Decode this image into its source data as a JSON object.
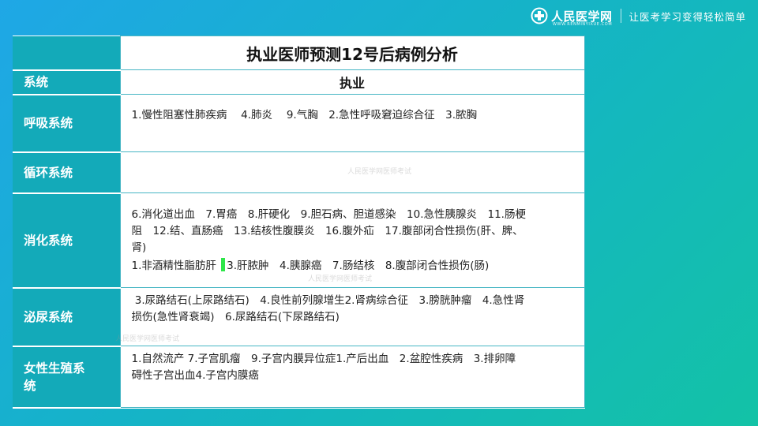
{
  "brand": {
    "name": "人民医学网",
    "site": "WWW.RENMINYIXUE.COM",
    "slogan": "让医考学习变得轻松简单"
  },
  "table": {
    "title": "执业医师预测12号后病例分析",
    "header_label": "系统",
    "header_value": "执业",
    "rows": [
      {
        "label": "呼吸系统",
        "lines": [
          "1.慢性阻塞性肺疾病　 4.肺炎　 9.气胸　2.急性呼吸窘迫综合征　3.脓胸"
        ]
      },
      {
        "label": "循环系统",
        "lines": []
      },
      {
        "label": "消化系统",
        "lines": [
          "6.消化道出血　7.胃癌　8.肝硬化　9.胆石病、胆道感染　10.急性胰腺炎　11.肠梗",
          "阻　12.结、直肠癌　13.结核性腹膜炎　16.腹外疝　17.腹部闭合性损伤(肝、脾、",
          "肾)"
        ],
        "line4_a": "1.非酒精性脂肪肝 ",
        "line4_b": "3.肝脓肿　4.胰腺癌　7.肠结核　8.腹部闭合性损伤(肠)"
      },
      {
        "label": "泌尿系统",
        "lines": [
          " 3.尿路结石(上尿路结石)　4.良性前列腺增生2.肾病综合征　3.膀胱肿瘤　4.急性肾",
          "损伤(急性肾衰竭)　6.尿路结石(下尿路结石)"
        ]
      },
      {
        "label": "女性生殖系统",
        "label_l1": "女性生殖系",
        "label_l2": "统",
        "lines": [
          "1.自然流产 7.子宫肌瘤　9.子宫内膜异位症1.产后出血　2.盆腔性疾病　3.排卵障",
          "碍性子宫出血4.子宫内膜癌"
        ]
      }
    ]
  },
  "watermark": "人民医学网医师考试",
  "colors": {
    "label_bg": "#13aab9",
    "cursor": "#2ee64a"
  }
}
